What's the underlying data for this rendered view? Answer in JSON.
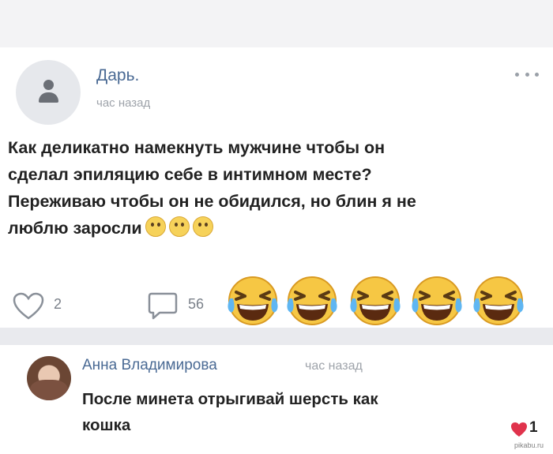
{
  "post": {
    "author": "Дарь.",
    "time": "час назад",
    "text_lines": [
      "Как деликатно намекнуть мужчине чтобы он",
      "сделал эпиляцию себе в интимном месте?",
      "Переживаю чтобы он не обидился, но блин я не",
      "люблю заросли"
    ],
    "like_count": "2",
    "comment_count": "56"
  },
  "comment": {
    "author": "Анна Владимирова",
    "time": "час назад",
    "text_lines": [
      "После минета отрыгивай шерсть как",
      "кошка"
    ],
    "like_count": "1"
  },
  "watermark": "pikabu.ru",
  "colors": {
    "link": "#4a6a94",
    "muted": "#9ea3aa",
    "heart": "#e0334c",
    "emoji": "#f6d25a"
  }
}
